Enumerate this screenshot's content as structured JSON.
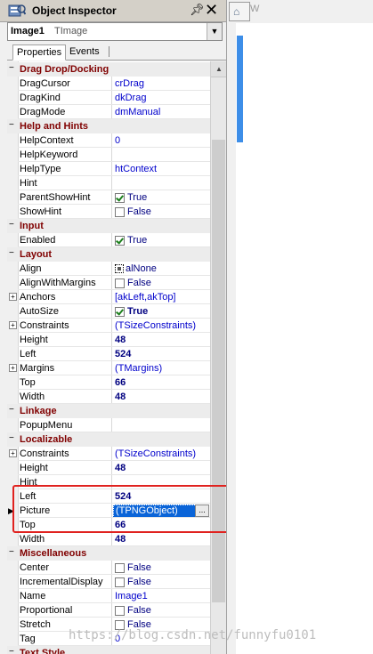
{
  "window": {
    "title": "Object Inspector",
    "icons": {
      "app": "inspector-icon",
      "pin": "pin-icon",
      "close": "close-icon"
    }
  },
  "selector": {
    "name": "Image1",
    "type": "TImage"
  },
  "tabs": [
    {
      "label": "Properties",
      "active": true
    },
    {
      "label": "Events",
      "active": false
    }
  ],
  "right_pane": {
    "tab_label": "W",
    "icon": "home-icon",
    "accent_color": "#3d8ee8"
  },
  "colors": {
    "category_text": "#800000",
    "value_text": "#000080",
    "highlight_box": "#e0221f",
    "selection": "#0a64d8"
  },
  "rows": [
    {
      "kind": "category",
      "name": "Drag Drop/Docking"
    },
    {
      "kind": "prop",
      "name": "DragCursor",
      "value": "crDrag"
    },
    {
      "kind": "prop",
      "name": "DragKind",
      "value": "dkDrag"
    },
    {
      "kind": "prop",
      "name": "DragMode",
      "value": "dmManual"
    },
    {
      "kind": "category",
      "name": "Help and Hints"
    },
    {
      "kind": "prop",
      "name": "HelpContext",
      "value": "0"
    },
    {
      "kind": "prop",
      "name": "HelpKeyword",
      "value": ""
    },
    {
      "kind": "prop",
      "name": "HelpType",
      "value": "htContext"
    },
    {
      "kind": "prop",
      "name": "Hint",
      "value": ""
    },
    {
      "kind": "bool",
      "name": "ParentShowHint",
      "value": "True",
      "checked": true
    },
    {
      "kind": "bool",
      "name": "ShowHint",
      "value": "False",
      "checked": false
    },
    {
      "kind": "category",
      "name": "Input"
    },
    {
      "kind": "bool",
      "name": "Enabled",
      "value": "True",
      "checked": true
    },
    {
      "kind": "category",
      "name": "Layout"
    },
    {
      "kind": "align",
      "name": "Align",
      "value": "alNone"
    },
    {
      "kind": "bool",
      "name": "AlignWithMargins",
      "value": "False",
      "checked": false
    },
    {
      "kind": "prop",
      "name": "Anchors",
      "value": "[akLeft,akTop]",
      "expandable": true
    },
    {
      "kind": "bool",
      "name": "AutoSize",
      "value": "True",
      "checked": true,
      "bold": true
    },
    {
      "kind": "prop",
      "name": "Constraints",
      "value": "(TSizeConstraints)",
      "expandable": true
    },
    {
      "kind": "prop",
      "name": "Height",
      "value": "48",
      "bold": true
    },
    {
      "kind": "prop",
      "name": "Left",
      "value": "524",
      "bold": true
    },
    {
      "kind": "prop",
      "name": "Margins",
      "value": "(TMargins)",
      "expandable": true
    },
    {
      "kind": "prop",
      "name": "Top",
      "value": "66",
      "bold": true
    },
    {
      "kind": "prop",
      "name": "Width",
      "value": "48",
      "bold": true
    },
    {
      "kind": "category",
      "name": "Linkage"
    },
    {
      "kind": "prop",
      "name": "PopupMenu",
      "value": ""
    },
    {
      "kind": "category",
      "name": "Localizable"
    },
    {
      "kind": "prop",
      "name": "Constraints",
      "value": "(TSizeConstraints)",
      "expandable": true
    },
    {
      "kind": "prop",
      "name": "Height",
      "value": "48",
      "bold": true
    },
    {
      "kind": "prop",
      "name": "Hint",
      "value": ""
    },
    {
      "kind": "prop",
      "name": "Left",
      "value": "524",
      "bold": true
    },
    {
      "kind": "edit",
      "name": "Picture",
      "value": "(TPNGObject)",
      "button": "..."
    },
    {
      "kind": "prop",
      "name": "Top",
      "value": "66",
      "bold": true
    },
    {
      "kind": "prop",
      "name": "Width",
      "value": "48",
      "bold": true
    },
    {
      "kind": "category",
      "name": "Miscellaneous"
    },
    {
      "kind": "bool",
      "name": "Center",
      "value": "False",
      "checked": false
    },
    {
      "kind": "bool",
      "name": "IncrementalDisplay",
      "value": "False",
      "checked": false
    },
    {
      "kind": "prop",
      "name": "Name",
      "value": "Image1"
    },
    {
      "kind": "bool",
      "name": "Proportional",
      "value": "False",
      "checked": false
    },
    {
      "kind": "bool",
      "name": "Stretch",
      "value": "False",
      "checked": false
    },
    {
      "kind": "prop",
      "name": "Tag",
      "value": "0"
    },
    {
      "kind": "category",
      "name": "Text Style"
    }
  ],
  "watermark": "https://blog.csdn.net/funnyfu0101"
}
